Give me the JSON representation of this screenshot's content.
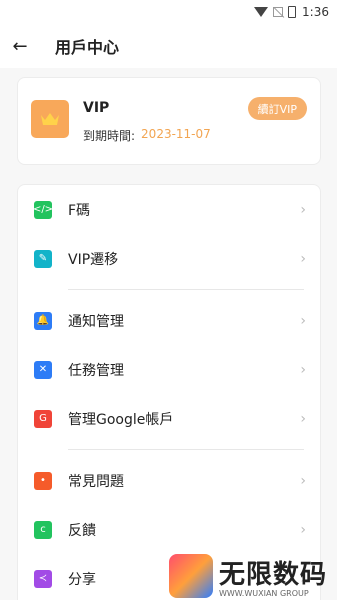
{
  "status": {
    "time": "1:36"
  },
  "appbar": {
    "title": "用戶中心"
  },
  "vip": {
    "title": "VIP",
    "expiry_label": "到期時間:",
    "expiry_date": "2023-11-07",
    "renew_label": "續訂VIP"
  },
  "menu": {
    "items": [
      {
        "label": "F碼",
        "icon": "code-icon",
        "color": "#22c35e"
      },
      {
        "label": "VIP遷移",
        "icon": "edit-note-icon",
        "color": "#12b3c9"
      },
      {
        "label": "通知管理",
        "icon": "bell-icon",
        "color": "#2d7cf6"
      },
      {
        "label": "任務管理",
        "icon": "tools-icon",
        "color": "#2d7cf6"
      },
      {
        "label": "管理Google帳戶",
        "icon": "google-icon",
        "color": "#f04438"
      },
      {
        "label": "常見問題",
        "icon": "faq-icon",
        "color": "#f55b2a"
      },
      {
        "label": "反饋",
        "icon": "feedback-icon",
        "color": "#22c35e"
      },
      {
        "label": "分享",
        "icon": "share-icon",
        "color": "#a24be6"
      }
    ]
  },
  "watermark": {
    "text": "无限数码",
    "sub": "WWW.WUXIAN GROUP"
  }
}
